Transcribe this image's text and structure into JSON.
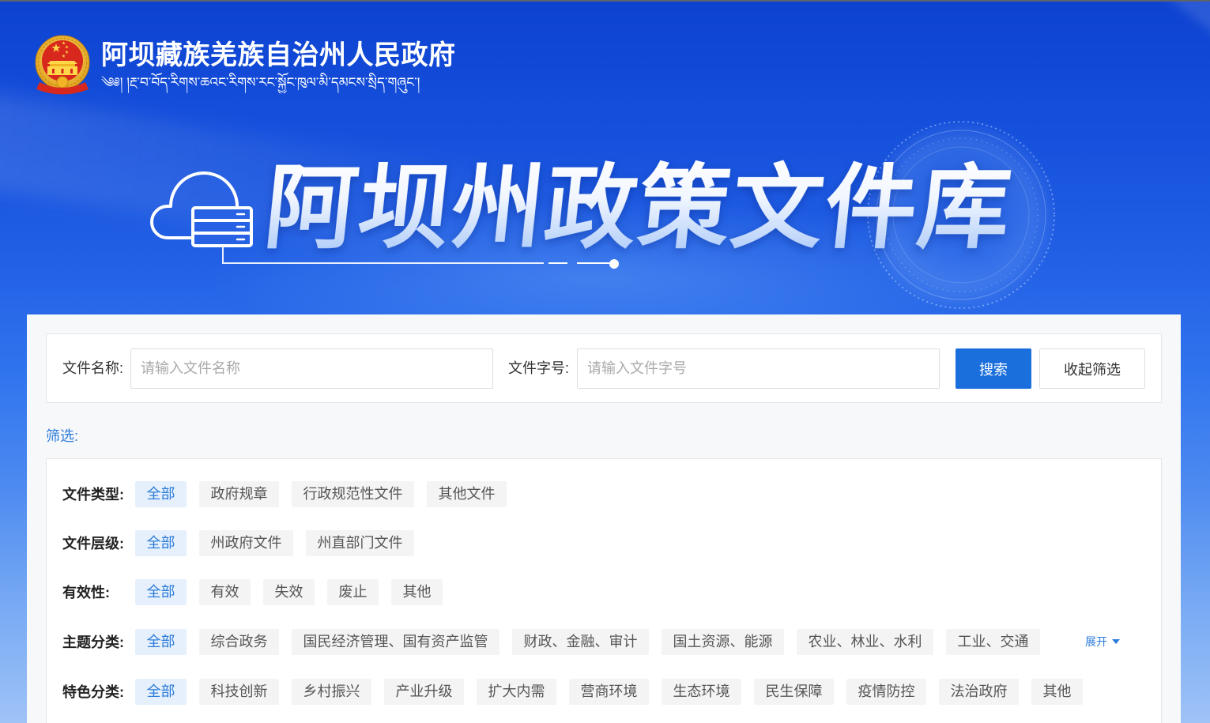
{
  "header": {
    "gov_title": "阿坝藏族羌族自治州人民政府",
    "gov_subtitle": "༄༅། །རྔ་བ་བོད་རིགས་ཆའང་རིགས་རང་སྐྱོང་ཁུལ་མི་དམངས་སྲིད་གཞུང་།",
    "banner_title": "阿坝州政策文件库"
  },
  "search": {
    "name_label": "文件名称:",
    "name_placeholder": "请输入文件名称",
    "name_value": "",
    "number_label": "文件字号:",
    "number_placeholder": "请输入文件字号",
    "number_value": "",
    "search_button": "搜索",
    "collapse_button": "收起筛选"
  },
  "filter": {
    "title": "筛选:",
    "expand_label": "展开",
    "groups": [
      {
        "label": "文件类型:",
        "selected_index": 0,
        "options": [
          "全部",
          "政府规章",
          "行政规范性文件",
          "其他文件"
        ]
      },
      {
        "label": "文件层级:",
        "selected_index": 0,
        "options": [
          "全部",
          "州政府文件",
          "州直部门文件"
        ]
      },
      {
        "label": "有效性:",
        "selected_index": 0,
        "options": [
          "全部",
          "有效",
          "失效",
          "废止",
          "其他"
        ]
      },
      {
        "label": "主题分类:",
        "selected_index": 0,
        "options": [
          "全部",
          "综合政务",
          "国民经济管理、国有资产监管",
          "财政、金融、审计",
          "国土资源、能源",
          "农业、林业、水利",
          "工业、交通"
        ]
      },
      {
        "label": "特色分类:",
        "selected_index": 0,
        "options": [
          "全部",
          "科技创新",
          "乡村振兴",
          "产业升级",
          "扩大内需",
          "营商环境",
          "生态环境",
          "民生保障",
          "疫情防控",
          "法治政府",
          "其他"
        ]
      }
    ]
  },
  "icons": {
    "emblem": "national-emblem-icon",
    "banner_logo": "cloud-server-icon",
    "expand": "caret-down-icon"
  },
  "colors": {
    "accent": "#1b6fdc",
    "link": "#2b7bd9",
    "tag-active-bg": "#e6f0fc",
    "tag-active-text": "#2b7bd9",
    "tag-bg": "#f4f4f5",
    "tag-text": "#555555",
    "panel-bg": "#f7f8fa",
    "border": "#e4e6ea"
  }
}
